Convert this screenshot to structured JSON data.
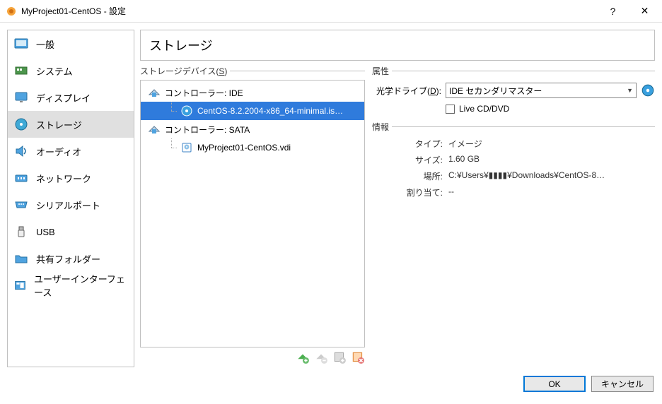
{
  "window": {
    "title": "MyProject01-CentOS - 設定",
    "help_icon": "?",
    "close_icon": "✕"
  },
  "sidebar": {
    "items": [
      {
        "label": "一般",
        "icon": "general"
      },
      {
        "label": "システム",
        "icon": "system"
      },
      {
        "label": "ディスプレイ",
        "icon": "display"
      },
      {
        "label": "ストレージ",
        "icon": "storage",
        "selected": true
      },
      {
        "label": "オーディオ",
        "icon": "audio"
      },
      {
        "label": "ネットワーク",
        "icon": "network"
      },
      {
        "label": "シリアルポート",
        "icon": "serial"
      },
      {
        "label": "USB",
        "icon": "usb"
      },
      {
        "label": "共有フォルダー",
        "icon": "shared"
      },
      {
        "label": "ユーザーインターフェース",
        "icon": "ui"
      }
    ]
  },
  "page": {
    "title": "ストレージ",
    "devices_group": "ストレージデバイス(S)",
    "devices_access_key": "S",
    "attrs_group": "属性",
    "info_group": "情報",
    "tree": {
      "ide_label": "コントローラー: IDE",
      "iso_label": "CentOS-8.2.2004-x86_64-minimal.is…",
      "sata_label": "コントローラー: SATA",
      "vdi_label": "MyProject01-CentOS.vdi"
    },
    "attrs": {
      "optical_label_text": "光学ドライブ(D):",
      "optical_access_key": "D",
      "optical_value": "IDE セカンダリマスター",
      "live_label": "Live CD/DVD"
    },
    "info": {
      "type_key": "タイプ:",
      "type_val": "イメージ",
      "size_key": "サイズ:",
      "size_val": "1.60 GB",
      "loc_key": "場所:",
      "loc_val": "C:¥Users¥▮▮▮▮¥Downloads¥CentOS-8…",
      "assign_key": "割り当て:",
      "assign_val": "--"
    }
  },
  "buttons": {
    "ok": "OK",
    "cancel": "キャンセル"
  }
}
